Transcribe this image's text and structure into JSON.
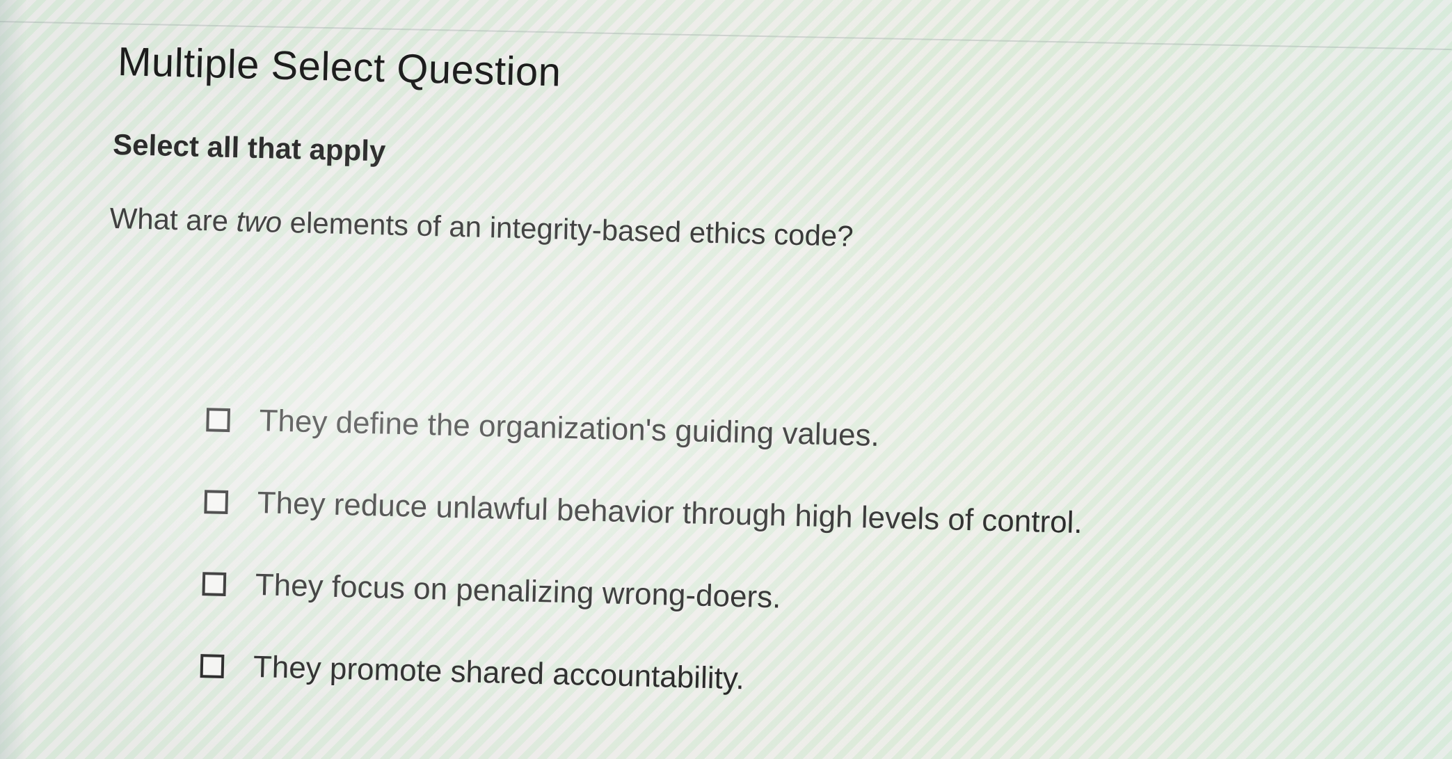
{
  "question": {
    "title": "Multiple Select Question",
    "instruction": "Select all that apply",
    "prompt_before": "What are ",
    "prompt_emphasis": "two",
    "prompt_after": " elements of an integrity-based ethics code?"
  },
  "options": [
    {
      "label": "They define the organization's guiding values.",
      "checked": false
    },
    {
      "label": "They reduce unlawful behavior through high levels of control.",
      "checked": false
    },
    {
      "label": "They focus on penalizing wrong-doers.",
      "checked": false
    },
    {
      "label": "They promote shared accountability.",
      "checked": false
    }
  ]
}
